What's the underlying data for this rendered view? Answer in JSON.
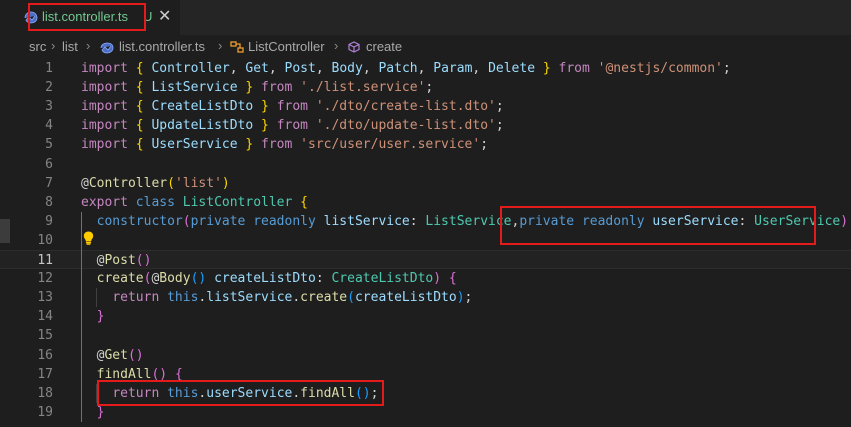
{
  "tab": {
    "label": "list.controller.ts",
    "badge": "U"
  },
  "breadcrumb": [
    "src",
    "list",
    "list.controller.ts",
    "ListController",
    "create"
  ],
  "lines": [
    {
      "n": "1",
      "tokens": [
        [
          "c",
          "import"
        ],
        [
          "p",
          " "
        ],
        [
          "y",
          "{"
        ],
        [
          "p",
          " "
        ],
        [
          "v",
          "Controller"
        ],
        [
          "p",
          ", "
        ],
        [
          "v",
          "Get"
        ],
        [
          "p",
          ", "
        ],
        [
          "v",
          "Post"
        ],
        [
          "p",
          ", "
        ],
        [
          "v",
          "Body"
        ],
        [
          "p",
          ", "
        ],
        [
          "v",
          "Patch"
        ],
        [
          "p",
          ", "
        ],
        [
          "v",
          "Param"
        ],
        [
          "p",
          ", "
        ],
        [
          "v",
          "Delete"
        ],
        [
          "p",
          " "
        ],
        [
          "y",
          "}"
        ],
        [
          "p",
          " "
        ],
        [
          "c",
          "from"
        ],
        [
          "p",
          " "
        ],
        [
          "s",
          "'@nestjs/common'"
        ],
        [
          "p",
          ";"
        ]
      ]
    },
    {
      "n": "2",
      "tokens": [
        [
          "c",
          "import"
        ],
        [
          "p",
          " "
        ],
        [
          "y",
          "{"
        ],
        [
          "p",
          " "
        ],
        [
          "v",
          "ListService"
        ],
        [
          "p",
          " "
        ],
        [
          "y",
          "}"
        ],
        [
          "p",
          " "
        ],
        [
          "c",
          "from"
        ],
        [
          "p",
          " "
        ],
        [
          "s",
          "'./list.service'"
        ],
        [
          "p",
          ";"
        ]
      ]
    },
    {
      "n": "3",
      "tokens": [
        [
          "c",
          "import"
        ],
        [
          "p",
          " "
        ],
        [
          "y",
          "{"
        ],
        [
          "p",
          " "
        ],
        [
          "v",
          "CreateListDto"
        ],
        [
          "p",
          " "
        ],
        [
          "y",
          "}"
        ],
        [
          "p",
          " "
        ],
        [
          "c",
          "from"
        ],
        [
          "p",
          " "
        ],
        [
          "s",
          "'./dto/create-list.dto'"
        ],
        [
          "p",
          ";"
        ]
      ]
    },
    {
      "n": "4",
      "tokens": [
        [
          "c",
          "import"
        ],
        [
          "p",
          " "
        ],
        [
          "y",
          "{"
        ],
        [
          "p",
          " "
        ],
        [
          "v",
          "UpdateListDto"
        ],
        [
          "p",
          " "
        ],
        [
          "y",
          "}"
        ],
        [
          "p",
          " "
        ],
        [
          "c",
          "from"
        ],
        [
          "p",
          " "
        ],
        [
          "s",
          "'./dto/update-list.dto'"
        ],
        [
          "p",
          ";"
        ]
      ]
    },
    {
      "n": "5",
      "tokens": [
        [
          "c",
          "import"
        ],
        [
          "p",
          " "
        ],
        [
          "y",
          "{"
        ],
        [
          "p",
          " "
        ],
        [
          "v",
          "UserService"
        ],
        [
          "p",
          " "
        ],
        [
          "y",
          "}"
        ],
        [
          "p",
          " "
        ],
        [
          "c",
          "from"
        ],
        [
          "p",
          " "
        ],
        [
          "s",
          "'src/user/user.service'"
        ],
        [
          "p",
          ";"
        ]
      ]
    },
    {
      "n": "6",
      "tokens": []
    },
    {
      "n": "7",
      "tokens": [
        [
          "p",
          "@"
        ],
        [
          "f",
          "Controller"
        ],
        [
          "y",
          "("
        ],
        [
          "s",
          "'list'"
        ],
        [
          "y",
          ")"
        ]
      ]
    },
    {
      "n": "8",
      "tokens": [
        [
          "c",
          "export"
        ],
        [
          "p",
          " "
        ],
        [
          "k",
          "class"
        ],
        [
          "p",
          " "
        ],
        [
          "t",
          "ListController"
        ],
        [
          "p",
          " "
        ],
        [
          "y",
          "{"
        ]
      ]
    },
    {
      "n": "9",
      "tokens": [
        [
          "p",
          "  "
        ],
        [
          "k",
          "constructor"
        ],
        [
          "bp",
          "("
        ],
        [
          "k",
          "private"
        ],
        [
          "p",
          " "
        ],
        [
          "k",
          "readonly"
        ],
        [
          "p",
          " "
        ],
        [
          "v",
          "listService"
        ],
        [
          "p",
          ": "
        ],
        [
          "t",
          "ListService"
        ],
        [
          "p",
          ","
        ],
        [
          "k",
          "private"
        ],
        [
          "p",
          " "
        ],
        [
          "k",
          "readonly"
        ],
        [
          "p",
          " "
        ],
        [
          "v",
          "userService"
        ],
        [
          "p",
          ": "
        ],
        [
          "t",
          "UserService"
        ],
        [
          "bp",
          ")"
        ],
        [
          "p",
          " "
        ],
        [
          "bp",
          "{}"
        ]
      ]
    },
    {
      "n": "10",
      "tokens": []
    },
    {
      "n": "11",
      "tokens": [
        [
          "p",
          "  @"
        ],
        [
          "f",
          "Post"
        ],
        [
          "bp",
          "()"
        ]
      ]
    },
    {
      "n": "12",
      "tokens": [
        [
          "p",
          "  "
        ],
        [
          "f",
          "create"
        ],
        [
          "bp",
          "("
        ],
        [
          "p",
          "@"
        ],
        [
          "f",
          "Body"
        ],
        [
          "bb",
          "()"
        ],
        [
          "p",
          " "
        ],
        [
          "v",
          "createListDto"
        ],
        [
          "p",
          ": "
        ],
        [
          "t",
          "CreateListDto"
        ],
        [
          "bp",
          ")"
        ],
        [
          "p",
          " "
        ],
        [
          "bp",
          "{"
        ]
      ]
    },
    {
      "n": "13",
      "tokens": [
        [
          "p",
          "    "
        ],
        [
          "c",
          "return"
        ],
        [
          "p",
          " "
        ],
        [
          "k",
          "this"
        ],
        [
          "p",
          "."
        ],
        [
          "v",
          "listService"
        ],
        [
          "p",
          "."
        ],
        [
          "f",
          "create"
        ],
        [
          "bb",
          "("
        ],
        [
          "v",
          "createListDto"
        ],
        [
          "bb",
          ")"
        ],
        [
          "p",
          ";"
        ]
      ]
    },
    {
      "n": "14",
      "tokens": [
        [
          "p",
          "  "
        ],
        [
          "bp",
          "}"
        ]
      ]
    },
    {
      "n": "15",
      "tokens": []
    },
    {
      "n": "16",
      "tokens": [
        [
          "p",
          "  @"
        ],
        [
          "f",
          "Get"
        ],
        [
          "bp",
          "()"
        ]
      ]
    },
    {
      "n": "17",
      "tokens": [
        [
          "p",
          "  "
        ],
        [
          "f",
          "findAll"
        ],
        [
          "bp",
          "()"
        ],
        [
          "p",
          " "
        ],
        [
          "bp",
          "{"
        ]
      ]
    },
    {
      "n": "18",
      "tokens": [
        [
          "p",
          "    "
        ],
        [
          "c",
          "return"
        ],
        [
          "p",
          " "
        ],
        [
          "k",
          "this"
        ],
        [
          "p",
          "."
        ],
        [
          "v",
          "userService"
        ],
        [
          "p",
          "."
        ],
        [
          "f",
          "findAll"
        ],
        [
          "bb",
          "()"
        ],
        [
          "p",
          ";"
        ]
      ]
    },
    {
      "n": "19",
      "tokens": [
        [
          "p",
          "  "
        ],
        [
          "bp",
          "}"
        ]
      ]
    }
  ],
  "active_line": "11",
  "colors": {
    "annotation": "#e31b1b",
    "tab_text": "#73c991"
  }
}
